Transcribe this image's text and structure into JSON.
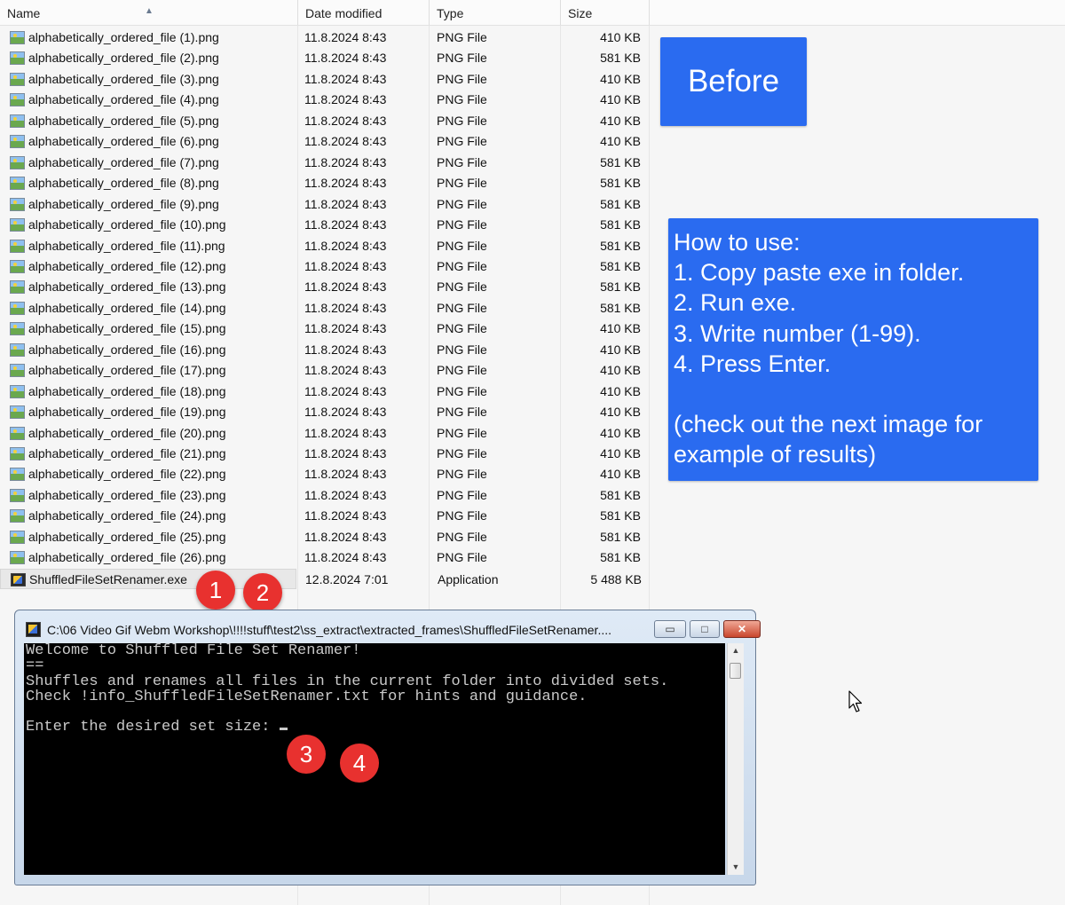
{
  "explorer": {
    "columns": {
      "name": "Name",
      "date": "Date modified",
      "type": "Type",
      "size": "Size"
    },
    "files": [
      {
        "name": "alphabetically_ordered_file (1).png",
        "date": "11.8.2024 8:43",
        "type": "PNG File",
        "size": "410 KB"
      },
      {
        "name": "alphabetically_ordered_file (2).png",
        "date": "11.8.2024 8:43",
        "type": "PNG File",
        "size": "581 KB"
      },
      {
        "name": "alphabetically_ordered_file (3).png",
        "date": "11.8.2024 8:43",
        "type": "PNG File",
        "size": "410 KB"
      },
      {
        "name": "alphabetically_ordered_file (4).png",
        "date": "11.8.2024 8:43",
        "type": "PNG File",
        "size": "410 KB"
      },
      {
        "name": "alphabetically_ordered_file (5).png",
        "date": "11.8.2024 8:43",
        "type": "PNG File",
        "size": "410 KB"
      },
      {
        "name": "alphabetically_ordered_file (6).png",
        "date": "11.8.2024 8:43",
        "type": "PNG File",
        "size": "410 KB"
      },
      {
        "name": "alphabetically_ordered_file (7).png",
        "date": "11.8.2024 8:43",
        "type": "PNG File",
        "size": "581 KB"
      },
      {
        "name": "alphabetically_ordered_file (8).png",
        "date": "11.8.2024 8:43",
        "type": "PNG File",
        "size": "581 KB"
      },
      {
        "name": "alphabetically_ordered_file (9).png",
        "date": "11.8.2024 8:43",
        "type": "PNG File",
        "size": "581 KB"
      },
      {
        "name": "alphabetically_ordered_file (10).png",
        "date": "11.8.2024 8:43",
        "type": "PNG File",
        "size": "581 KB"
      },
      {
        "name": "alphabetically_ordered_file (11).png",
        "date": "11.8.2024 8:43",
        "type": "PNG File",
        "size": "581 KB"
      },
      {
        "name": "alphabetically_ordered_file (12).png",
        "date": "11.8.2024 8:43",
        "type": "PNG File",
        "size": "581 KB"
      },
      {
        "name": "alphabetically_ordered_file (13).png",
        "date": "11.8.2024 8:43",
        "type": "PNG File",
        "size": "581 KB"
      },
      {
        "name": "alphabetically_ordered_file (14).png",
        "date": "11.8.2024 8:43",
        "type": "PNG File",
        "size": "581 KB"
      },
      {
        "name": "alphabetically_ordered_file (15).png",
        "date": "11.8.2024 8:43",
        "type": "PNG File",
        "size": "410 KB"
      },
      {
        "name": "alphabetically_ordered_file (16).png",
        "date": "11.8.2024 8:43",
        "type": "PNG File",
        "size": "410 KB"
      },
      {
        "name": "alphabetically_ordered_file (17).png",
        "date": "11.8.2024 8:43",
        "type": "PNG File",
        "size": "410 KB"
      },
      {
        "name": "alphabetically_ordered_file (18).png",
        "date": "11.8.2024 8:43",
        "type": "PNG File",
        "size": "410 KB"
      },
      {
        "name": "alphabetically_ordered_file (19).png",
        "date": "11.8.2024 8:43",
        "type": "PNG File",
        "size": "410 KB"
      },
      {
        "name": "alphabetically_ordered_file (20).png",
        "date": "11.8.2024 8:43",
        "type": "PNG File",
        "size": "410 KB"
      },
      {
        "name": "alphabetically_ordered_file (21).png",
        "date": "11.8.2024 8:43",
        "type": "PNG File",
        "size": "410 KB"
      },
      {
        "name": "alphabetically_ordered_file (22).png",
        "date": "11.8.2024 8:43",
        "type": "PNG File",
        "size": "410 KB"
      },
      {
        "name": "alphabetically_ordered_file (23).png",
        "date": "11.8.2024 8:43",
        "type": "PNG File",
        "size": "581 KB"
      },
      {
        "name": "alphabetically_ordered_file (24).png",
        "date": "11.8.2024 8:43",
        "type": "PNG File",
        "size": "581 KB"
      },
      {
        "name": "alphabetically_ordered_file (25).png",
        "date": "11.8.2024 8:43",
        "type": "PNG File",
        "size": "581 KB"
      },
      {
        "name": "alphabetically_ordered_file (26).png",
        "date": "11.8.2024 8:43",
        "type": "PNG File",
        "size": "581 KB"
      },
      {
        "name": "ShuffledFileSetRenamer.exe",
        "date": "12.8.2024 7:01",
        "type": "Application",
        "size": "5 488 KB",
        "selected": true,
        "icon": "app-icon"
      }
    ]
  },
  "annotations": {
    "before_label": "Before",
    "howto_lines": [
      "How to use:",
      "1. Copy paste exe in folder.",
      "2. Run exe.",
      "3. Write number (1-99).",
      "4. Press Enter.",
      "",
      "(check out the next image for",
      "example of results)"
    ],
    "badges": [
      "1",
      "2",
      "3",
      "4"
    ]
  },
  "console": {
    "title": "C:\\06 Video Gif Webm Workshop\\!!!!stuff\\test2\\ss_extract\\extracted_frames\\ShuffledFileSetRenamer....",
    "buttons": {
      "minimize": "▭",
      "maximize": "□",
      "close": "✕"
    },
    "lines": [
      "Welcome to Shuffled File Set Renamer!",
      "==",
      "Shuffles and renames all files in the current folder into divided sets.",
      "Check !info_ShuffledFileSetRenamer.txt for hints and guidance.",
      "",
      "Enter the desired set size: "
    ]
  },
  "colors": {
    "callout_blue": "#2a6bf0",
    "badge_red": "#e8312f",
    "console_bg": "#000000",
    "console_text": "#c9c9c9"
  }
}
